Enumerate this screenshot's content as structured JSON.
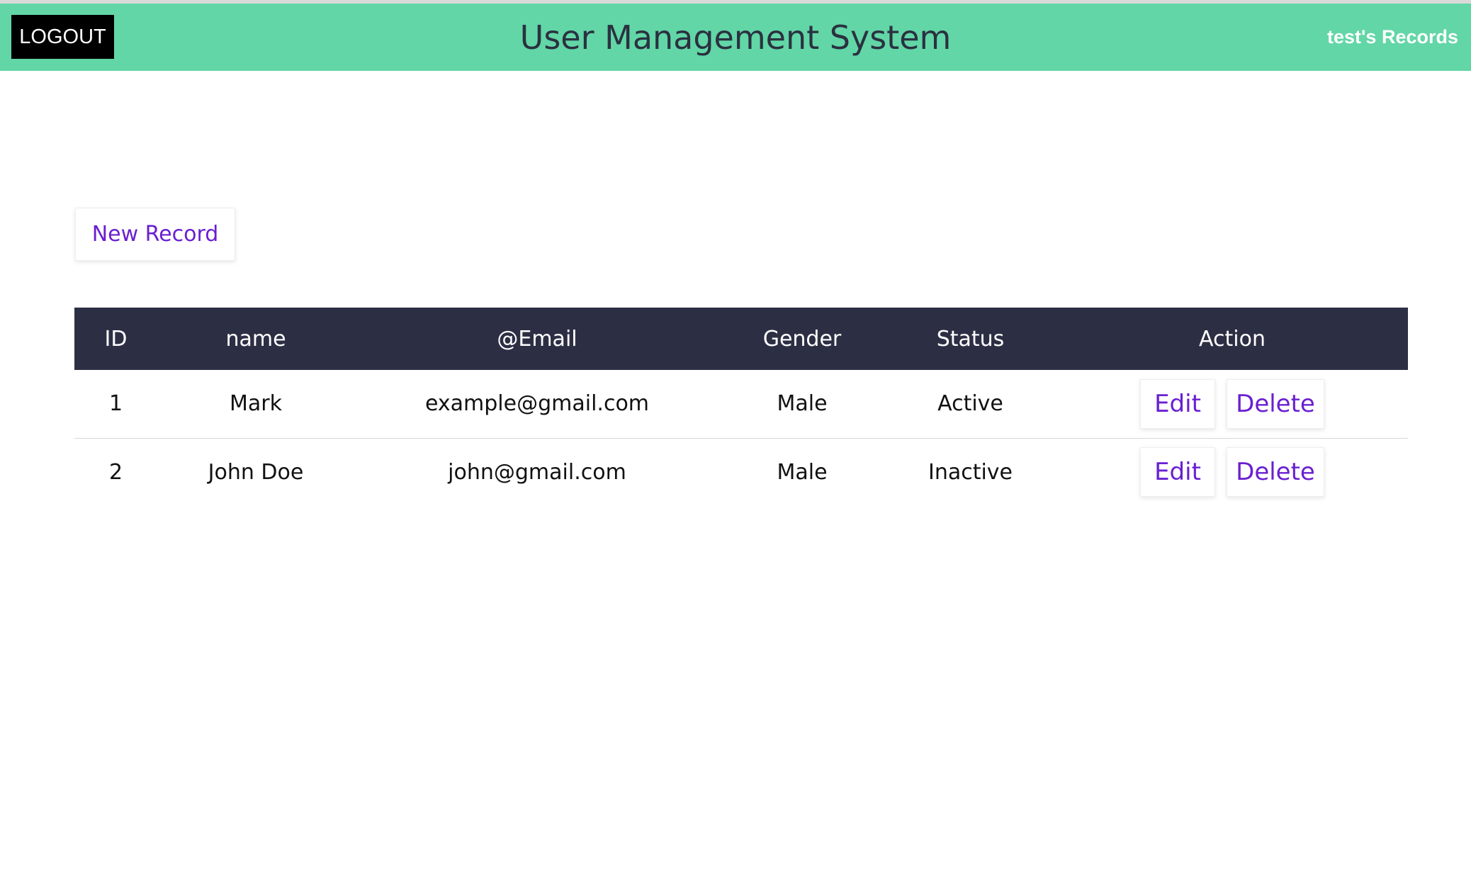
{
  "header": {
    "logout_label": "LOGOUT",
    "title": "User Management System",
    "records_label": "test's Records"
  },
  "main": {
    "new_record_label": "New Record"
  },
  "table": {
    "columns": [
      "ID",
      "name",
      "@Email",
      "Gender",
      "Status",
      "Action"
    ],
    "rows": [
      {
        "id": "1",
        "name": "Mark",
        "email": "example@gmail.com",
        "gender": "Male",
        "status": "Active",
        "edit_label": "Edit",
        "delete_label": "Delete"
      },
      {
        "id": "2",
        "name": "John Doe",
        "email": "john@gmail.com",
        "gender": "Male",
        "status": "Inactive",
        "edit_label": "Edit",
        "delete_label": "Delete"
      }
    ]
  },
  "colors": {
    "header_bg": "#62d6a6",
    "table_header_bg": "#2c2f44",
    "link_purple": "#6a1fd1",
    "logout_bg": "#000000"
  }
}
